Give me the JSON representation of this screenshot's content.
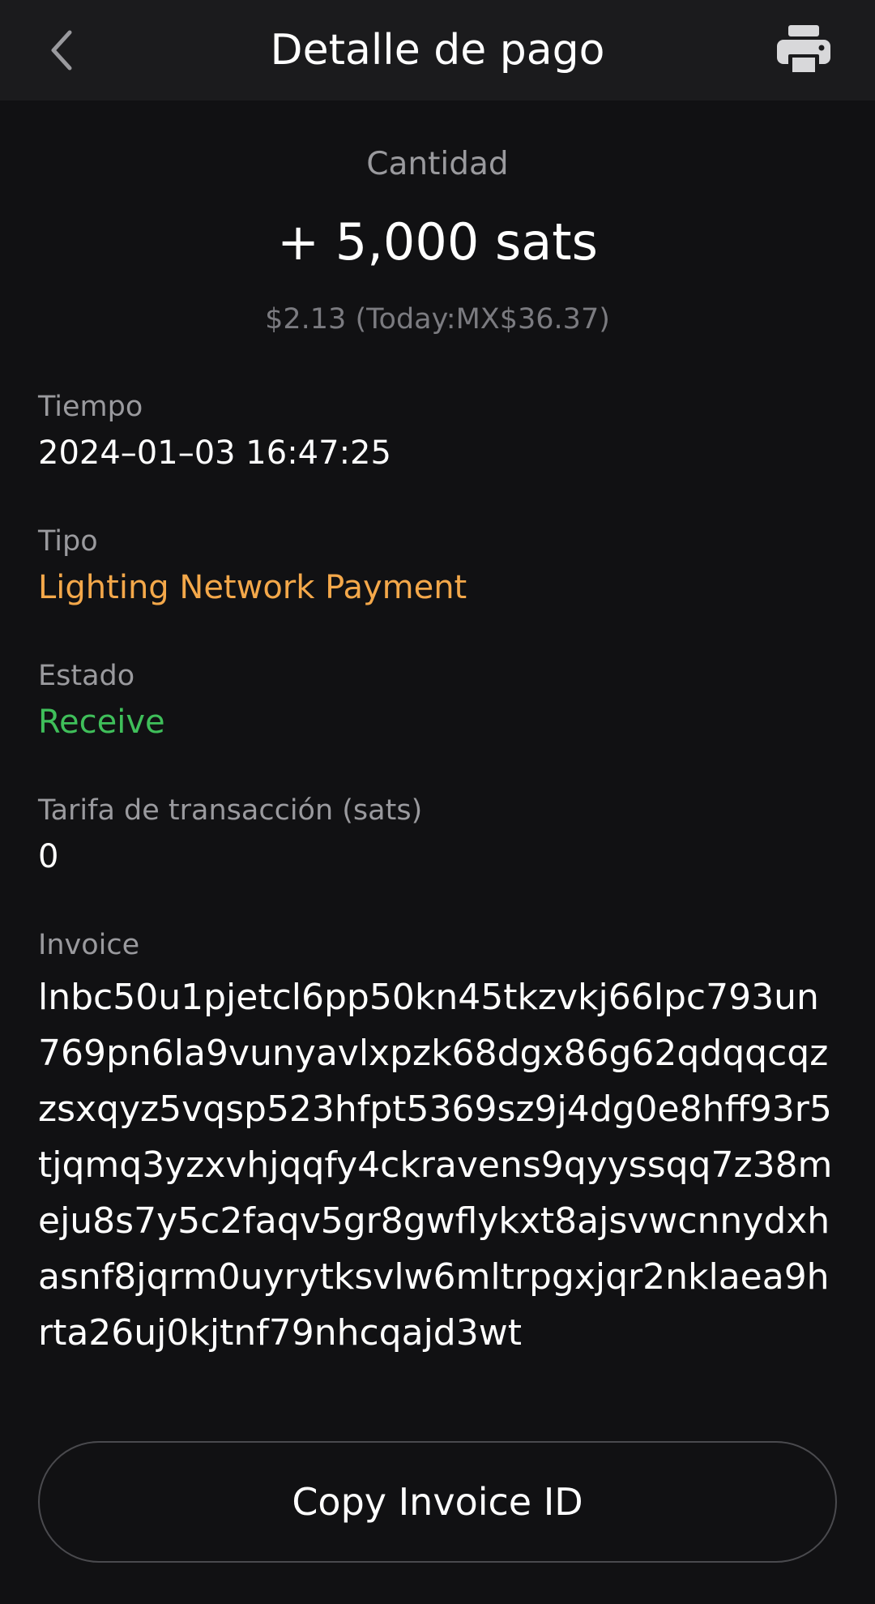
{
  "header": {
    "title": "Detalle de pago",
    "back_icon": "chevron-left-icon",
    "print_icon": "printer-icon"
  },
  "amount": {
    "label": "Cantidad",
    "value": "+ 5,000 sats",
    "fiat": "$2.13 (Today:MX$36.37)"
  },
  "fields": {
    "time": {
      "label": "Tiempo",
      "value": "2024–01–03 16:47:25"
    },
    "type": {
      "label": "Tipo",
      "value": "Lighting Network Payment",
      "color": "#f4a84a"
    },
    "status": {
      "label": "Estado",
      "value": "Receive",
      "color": "#3fbf5a"
    },
    "fee": {
      "label": "Tarifa de transacción (sats)",
      "value": "0"
    },
    "invoice": {
      "label": "Invoice",
      "value": "lnbc50u1pjetcl6pp50kn45tkzvkj66lpc793un769pn6la9vunyavlxpzk68dgx86g62qdqqcqzzsxqyz5vqsp523hfpt5369sz9j4dg0e8hff93r5tjqmq3yzxvhjqqfy4ckravens9qyyssqq7z38meju8s7y5c2faqv5gr8gwflykxt8ajsvwcnnydxhasnf8jqrm0uyrytksvlw6mltrpgxjqr2nklaea9hrta26uj0kjtnf79nhcqajd3wt"
    }
  },
  "actions": {
    "copy_label": "Copy Invoice ID"
  }
}
